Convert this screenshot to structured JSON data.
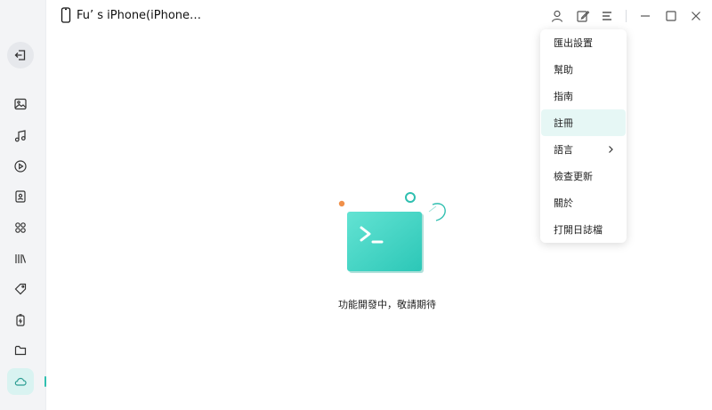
{
  "device": {
    "name": "Fu’ s iPhone(iPhone…",
    "icon": "phone-icon"
  },
  "toolbar": {
    "icons": [
      "user-icon",
      "edit-icon",
      "menu-icon",
      "minimize-icon",
      "maximize-icon",
      "close-icon"
    ]
  },
  "sidebar": {
    "items": [
      {
        "name": "exit",
        "icon": "exit-icon"
      },
      {
        "name": "photos",
        "icon": "image-icon"
      },
      {
        "name": "music",
        "icon": "music-icon"
      },
      {
        "name": "videos",
        "icon": "play-icon"
      },
      {
        "name": "contacts",
        "icon": "contacts-icon"
      },
      {
        "name": "apps",
        "icon": "apps-icon"
      },
      {
        "name": "books",
        "icon": "books-icon"
      },
      {
        "name": "tags",
        "icon": "tag-icon"
      },
      {
        "name": "backup",
        "icon": "battery-icon"
      },
      {
        "name": "files",
        "icon": "folder-icon"
      },
      {
        "name": "cloud",
        "icon": "cloud-icon",
        "active": true
      }
    ]
  },
  "menu": {
    "items": [
      {
        "label": "匯出設置"
      },
      {
        "label": "幫助"
      },
      {
        "label": "指南"
      },
      {
        "label": "註冊",
        "highlighted": true
      },
      {
        "label": "語言",
        "submenu": true
      },
      {
        "label": "檢查更新"
      },
      {
        "label": "關於"
      },
      {
        "label": "打開日誌檔"
      }
    ]
  },
  "content": {
    "message": "功能開發中，敬請期待",
    "illustration": "terminal-icon"
  },
  "colors": {
    "accent": "#2fbfb0",
    "orange_dot": "#f0904a",
    "highlight": "#e6f7f5"
  }
}
